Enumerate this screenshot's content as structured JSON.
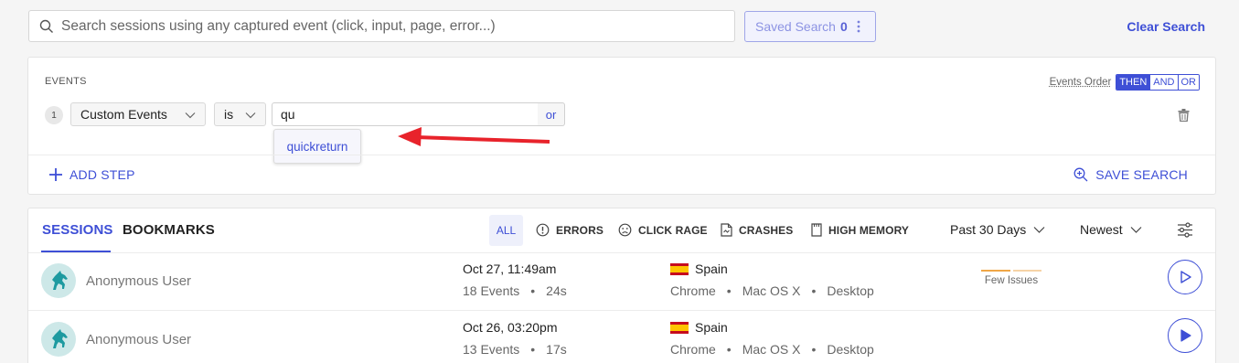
{
  "search": {
    "placeholder": "Search sessions using any captured event (click, input, page, error...)",
    "icon": "search-icon"
  },
  "saved_search": {
    "label": "Saved Search",
    "count": "0",
    "menu_icon": "vertical-dots-icon"
  },
  "clear_search": "Clear Search",
  "events": {
    "label": "EVENTS",
    "order_label": "Events Order",
    "order_options": [
      "THEN",
      "AND",
      "OR"
    ],
    "order_selected": "THEN",
    "steps": [
      {
        "number": "1",
        "type": "Custom Events",
        "operator": "is",
        "value": "qu",
        "or_label": "or",
        "suggestions": [
          "quickreturn"
        ]
      }
    ],
    "add_step": "ADD STEP",
    "save_search": "SAVE SEARCH",
    "accent": "#3e4fd6",
    "annotation_arrow_color": "#e8232b"
  },
  "sessions": {
    "tabs": [
      "SESSIONS",
      "BOOKMARKS"
    ],
    "active_tab": "SESSIONS",
    "filters": {
      "all": "ALL",
      "errors": "ERRORS",
      "click_rage": "CLICK RAGE",
      "crashes": "CRASHES",
      "high_memory": "HIGH MEMORY"
    },
    "period": "Past 30 Days",
    "sort": "Newest",
    "rows": [
      {
        "user": "Anonymous User",
        "date": "Oct 27, 11:49am",
        "events": "18 Events",
        "duration": "24s",
        "country": "Spain",
        "browser": "Chrome",
        "os": "Mac OS X",
        "device": "Desktop",
        "issues": "Few Issues"
      },
      {
        "user": "Anonymous User",
        "date": "Oct 26, 03:20pm",
        "events": "13 Events",
        "duration": "17s",
        "country": "Spain",
        "browser": "Chrome",
        "os": "Mac OS X",
        "device": "Desktop"
      }
    ]
  }
}
